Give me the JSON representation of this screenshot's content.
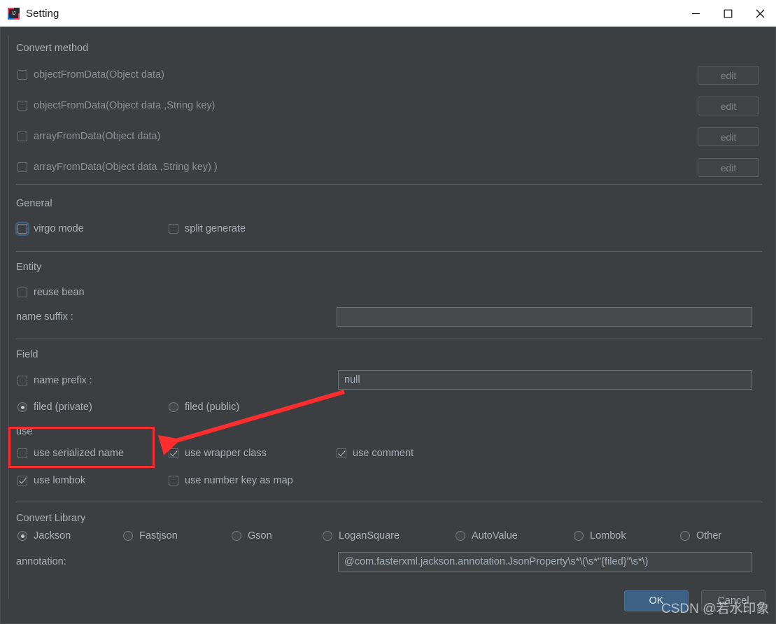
{
  "window": {
    "title": "Setting",
    "icon": "intellij-idea-icon",
    "controls": {
      "minimize": "minimize-icon",
      "maximize": "maximize-icon",
      "close": "close-icon"
    }
  },
  "convert_method": {
    "title": "Convert method",
    "items": [
      {
        "label": "objectFromData(Object data)",
        "checked": false,
        "edit_label": "edit",
        "edit_disabled": true
      },
      {
        "label": "objectFromData(Object data ,String key)",
        "checked": false,
        "edit_label": "edit",
        "edit_disabled": true
      },
      {
        "label": "arrayFromData(Object data)",
        "checked": false,
        "edit_label": "edit",
        "edit_disabled": true
      },
      {
        "label": "arrayFromData(Object data ,String key) )",
        "checked": false,
        "edit_label": "edit",
        "edit_disabled": true
      }
    ]
  },
  "general": {
    "title": "General",
    "virgo_mode": {
      "label": "virgo mode",
      "checked": false,
      "focused": true
    },
    "split_generate": {
      "label": "split generate",
      "checked": false
    }
  },
  "entity": {
    "title": "Entity",
    "reuse_bean": {
      "label": "reuse bean",
      "checked": false
    },
    "name_suffix": {
      "label": "name suffix :",
      "value": "",
      "placeholder": ""
    }
  },
  "field": {
    "title": "Field",
    "name_prefix": {
      "label": "name prefix :",
      "checked": false
    },
    "name_prefix_value": "null",
    "visibility": {
      "options": [
        {
          "label": "filed (private)",
          "selected": true
        },
        {
          "label": "filed (public)",
          "selected": false
        }
      ]
    }
  },
  "use": {
    "title": "use",
    "items": [
      {
        "label": "use serialized name",
        "checked": false
      },
      {
        "label": "use wrapper class",
        "checked": true
      },
      {
        "label": "use comment",
        "checked": true
      },
      {
        "label": "use lombok",
        "checked": true
      },
      {
        "label": "use number key as map",
        "checked": false
      }
    ]
  },
  "convert_library": {
    "title": "Convert Library",
    "options": [
      {
        "label": "Jackson",
        "selected": true
      },
      {
        "label": "Fastjson",
        "selected": false
      },
      {
        "label": "Gson",
        "selected": false
      },
      {
        "label": "LoganSquare",
        "selected": false
      },
      {
        "label": "AutoValue",
        "selected": false
      },
      {
        "label": "Lombok",
        "selected": false
      },
      {
        "label": "Other",
        "selected": false
      }
    ],
    "annotation": {
      "label": "annotation:",
      "value": "@com.fasterxml.jackson.annotation.JsonProperty\\s*\\(\\s*\"{filed}\"\\s*\\)"
    }
  },
  "footer": {
    "ok_label": "OK",
    "cancel_label": "Cancel"
  },
  "annotation_overlay": {
    "highlight_color": "#ff2d2d",
    "arrow_color": "#ff2d2d"
  },
  "watermark": {
    "text": "CSDN @若水印象"
  }
}
